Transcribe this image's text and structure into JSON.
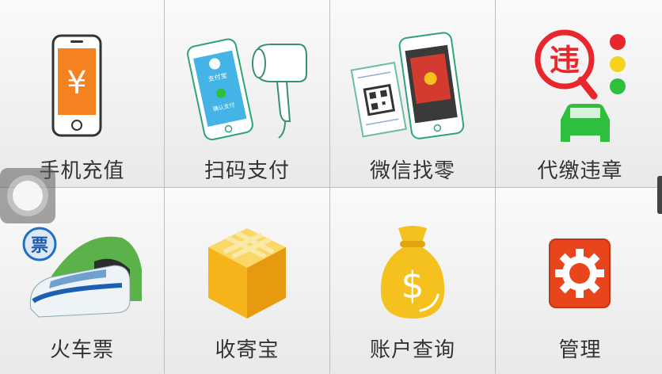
{
  "tiles": [
    {
      "label": "手机充值",
      "icon": "phone-recharge-icon",
      "symbol": "¥"
    },
    {
      "label": "扫码支付",
      "icon": "qr-scan-pay-icon",
      "phone_text": "支付宝",
      "confirm_text": "确认支付"
    },
    {
      "label": "微信找零",
      "icon": "wechat-change-icon"
    },
    {
      "label": "代缴违章",
      "icon": "traffic-violation-icon",
      "symbol": "违"
    },
    {
      "label": "火车票",
      "icon": "train-ticket-icon",
      "badge": "票"
    },
    {
      "label": "收寄宝",
      "icon": "parcel-box-icon"
    },
    {
      "label": "账户查询",
      "icon": "money-bag-icon",
      "symbol": "$"
    },
    {
      "label": "管理",
      "icon": "gear-icon"
    }
  ],
  "colors": {
    "orange": "#f58220",
    "red": "#e8262c",
    "green": "#2ec03c",
    "yellow": "#f5c11f",
    "gear_red": "#e8451d"
  }
}
